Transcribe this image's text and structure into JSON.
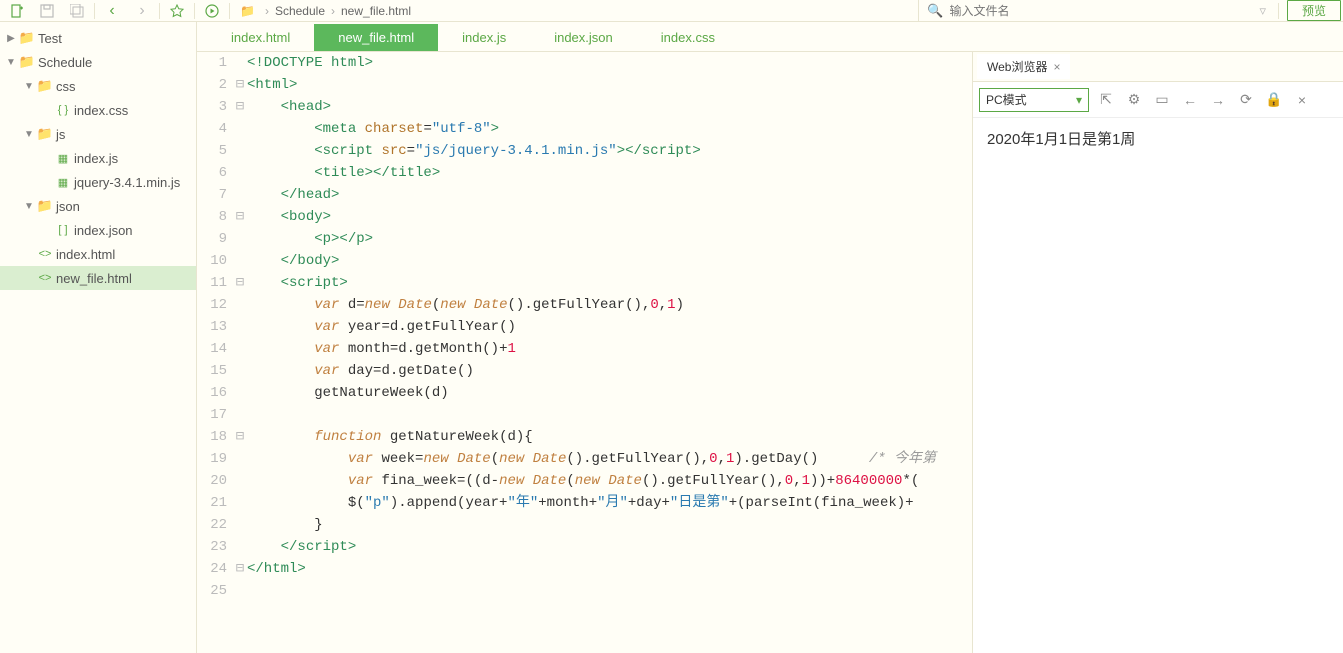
{
  "toolbar": {
    "preview_label": "预览"
  },
  "breadcrumb": {
    "folder": "Schedule",
    "file": "new_file.html"
  },
  "search": {
    "placeholder": "输入文件名"
  },
  "tree": {
    "items": [
      {
        "label": "Test",
        "indent": 0,
        "chev": "▶",
        "icon": "folder"
      },
      {
        "label": "Schedule",
        "indent": 0,
        "chev": "▼",
        "icon": "folder"
      },
      {
        "label": "css",
        "indent": 1,
        "chev": "▼",
        "icon": "folder"
      },
      {
        "label": "index.css",
        "indent": 2,
        "chev": "",
        "icon": "css"
      },
      {
        "label": "js",
        "indent": 1,
        "chev": "▼",
        "icon": "folder"
      },
      {
        "label": "index.js",
        "indent": 2,
        "chev": "",
        "icon": "js"
      },
      {
        "label": "jquery-3.4.1.min.js",
        "indent": 2,
        "chev": "",
        "icon": "js"
      },
      {
        "label": "json",
        "indent": 1,
        "chev": "▼",
        "icon": "folder"
      },
      {
        "label": "index.json",
        "indent": 2,
        "chev": "",
        "icon": "json"
      },
      {
        "label": "index.html",
        "indent": 1,
        "chev": "",
        "icon": "html"
      },
      {
        "label": "new_file.html",
        "indent": 1,
        "chev": "",
        "icon": "html",
        "selected": true
      }
    ]
  },
  "tabs": {
    "items": [
      {
        "label": "index.html",
        "active": false
      },
      {
        "label": "new_file.html",
        "active": true
      },
      {
        "label": "index.js",
        "active": false
      },
      {
        "label": "index.json",
        "active": false
      },
      {
        "label": "index.css",
        "active": false
      }
    ]
  },
  "code": {
    "lines": [
      {
        "n": 1,
        "f": "",
        "html": "<span class='c-tag'>&lt;!DOCTYPE html&gt;</span>"
      },
      {
        "n": 2,
        "f": "⊟",
        "html": "<span class='c-tag'>&lt;html&gt;</span>"
      },
      {
        "n": 3,
        "f": "⊟",
        "html": "    <span class='c-tag'>&lt;head&gt;</span>"
      },
      {
        "n": 4,
        "f": "",
        "html": "        <span class='c-tag'>&lt;meta</span> <span class='c-attr'>charset</span>=<span class='c-str'>\"utf-8\"</span><span class='c-tag'>&gt;</span>"
      },
      {
        "n": 5,
        "f": "",
        "html": "        <span class='c-tag'>&lt;script</span> <span class='c-attr'>src</span>=<span class='c-str'>\"js/jquery-3.4.1.min.js\"</span><span class='c-tag'>&gt;&lt;/script&gt;</span>"
      },
      {
        "n": 6,
        "f": "",
        "html": "        <span class='c-tag'>&lt;title&gt;&lt;/title&gt;</span>"
      },
      {
        "n": 7,
        "f": "",
        "html": "    <span class='c-tag'>&lt;/head&gt;</span>"
      },
      {
        "n": 8,
        "f": "⊟",
        "html": "    <span class='c-tag'>&lt;body&gt;</span>"
      },
      {
        "n": 9,
        "f": "",
        "html": "        <span class='c-tag'>&lt;p&gt;&lt;/p&gt;</span>"
      },
      {
        "n": 10,
        "f": "",
        "html": "    <span class='c-tag'>&lt;/body&gt;</span>"
      },
      {
        "n": 11,
        "f": "⊟",
        "html": "    <span class='c-tag'>&lt;script&gt;</span>"
      },
      {
        "n": 12,
        "f": "",
        "html": "        <span class='c-kw'>var</span> d=<span class='c-kw'>new</span> <span class='c-type'>Date</span>(<span class='c-kw'>new</span> <span class='c-type'>Date</span>().getFullYear(),<span class='c-num'>0</span>,<span class='c-num'>1</span>)"
      },
      {
        "n": 13,
        "f": "",
        "html": "        <span class='c-kw'>var</span> year=d.getFullYear()"
      },
      {
        "n": 14,
        "f": "",
        "html": "        <span class='c-kw'>var</span> month=d.getMonth()+<span class='c-num'>1</span>"
      },
      {
        "n": 15,
        "f": "",
        "html": "        <span class='c-kw'>var</span> day=d.getDate()"
      },
      {
        "n": 16,
        "f": "",
        "html": "        getNatureWeek(d)"
      },
      {
        "n": 17,
        "f": "",
        "html": ""
      },
      {
        "n": 18,
        "f": "⊟",
        "html": "        <span class='c-kw'>function</span> <span class='c-fn'>getNatureWeek</span>(d){"
      },
      {
        "n": 19,
        "f": "",
        "html": "            <span class='c-kw'>var</span> week=<span class='c-kw'>new</span> <span class='c-type'>Date</span>(<span class='c-kw'>new</span> <span class='c-type'>Date</span>().getFullYear(),<span class='c-num'>0</span>,<span class='c-num'>1</span>).getDay()      <span class='c-cmt'>/* 今年第</span>"
      },
      {
        "n": 20,
        "f": "",
        "html": "            <span class='c-kw'>var</span> fina_week=((d-<span class='c-kw'>new</span> <span class='c-type'>Date</span>(<span class='c-kw'>new</span> <span class='c-type'>Date</span>().getFullYear(),<span class='c-num'>0</span>,<span class='c-num'>1</span>))+<span class='c-num'>86400000</span>*("
      },
      {
        "n": 21,
        "f": "",
        "html": "            $(<span class='c-str'>\"p\"</span>).append(year+<span class='c-str'>\"年\"</span>+month+<span class='c-str'>\"月\"</span>+day+<span class='c-str'>\"日是第\"</span>+(parseInt(fina_week)+"
      },
      {
        "n": 22,
        "f": "",
        "html": "        }"
      },
      {
        "n": 23,
        "f": "",
        "html": "    <span class='c-tag'>&lt;/script&gt;</span>"
      },
      {
        "n": 24,
        "f": "⊟",
        "html": "<span class='c-tag'>&lt;/html&gt;</span>"
      },
      {
        "n": 25,
        "f": "",
        "html": ""
      }
    ]
  },
  "browser": {
    "tab_label": "Web浏览器",
    "mode_label": "PC模式",
    "output": "2020年1月1日是第1周"
  }
}
